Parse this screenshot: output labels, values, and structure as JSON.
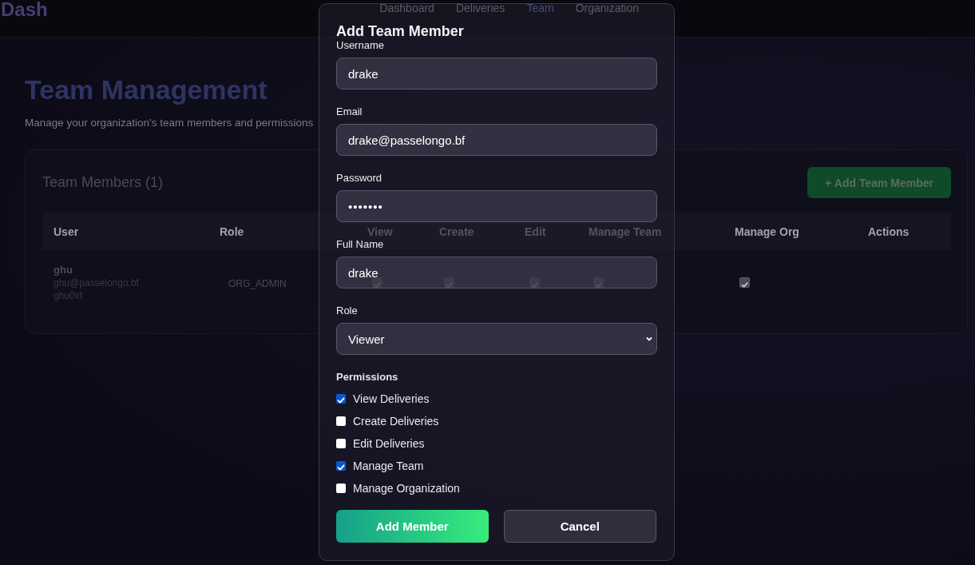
{
  "header": {
    "logo": "Dash",
    "nav": [
      {
        "label": "Dashboard",
        "selected": false
      },
      {
        "label": "Deliveries",
        "selected": false
      },
      {
        "label": "Team",
        "selected": true
      },
      {
        "label": "Organization",
        "selected": false
      }
    ]
  },
  "page": {
    "title": "Team Management",
    "subtitle": "Manage your organization's team members and permissions"
  },
  "card": {
    "title": "Team Members (1)",
    "add_button": "+ Add Team Member",
    "table": {
      "columns": [
        "User",
        "Role",
        "View",
        "Create",
        "Edit",
        "Manage Team",
        "Manage Org",
        "Actions"
      ],
      "rows": [
        {
          "name": "ghu",
          "email": "ghu@passelongo.bf",
          "handle": "ghu0xf",
          "role": "ORG_ADMIN",
          "permissions": [
            {
              "checked": true
            },
            {
              "checked": true
            },
            {
              "checked": true
            },
            {
              "checked": true
            },
            {
              "checked": true
            }
          ]
        }
      ]
    }
  },
  "modal": {
    "title": "Add Team Member",
    "fields": [
      {
        "label": "Username",
        "kind": "text",
        "value": "drake"
      },
      {
        "label": "Email",
        "kind": "text",
        "value": "drake@passelongo.bf"
      },
      {
        "label": "Password",
        "kind": "password",
        "value": "•••••••"
      },
      {
        "label": "Full Name",
        "kind": "text",
        "value": "drake"
      },
      {
        "label": "Role",
        "kind": "select",
        "value": "Viewer"
      }
    ],
    "permissions_heading": "Permissions",
    "permissions": [
      {
        "label": "View Deliveries",
        "checked": true
      },
      {
        "label": "Create Deliveries",
        "checked": false
      },
      {
        "label": "Edit Deliveries",
        "checked": false
      },
      {
        "label": "Manage Team",
        "checked": true
      },
      {
        "label": "Manage Organization",
        "checked": false
      }
    ],
    "buttons": [
      {
        "label": "Add Member",
        "kind": "primary"
      },
      {
        "label": "Cancel",
        "kind": "secondary"
      }
    ]
  }
}
